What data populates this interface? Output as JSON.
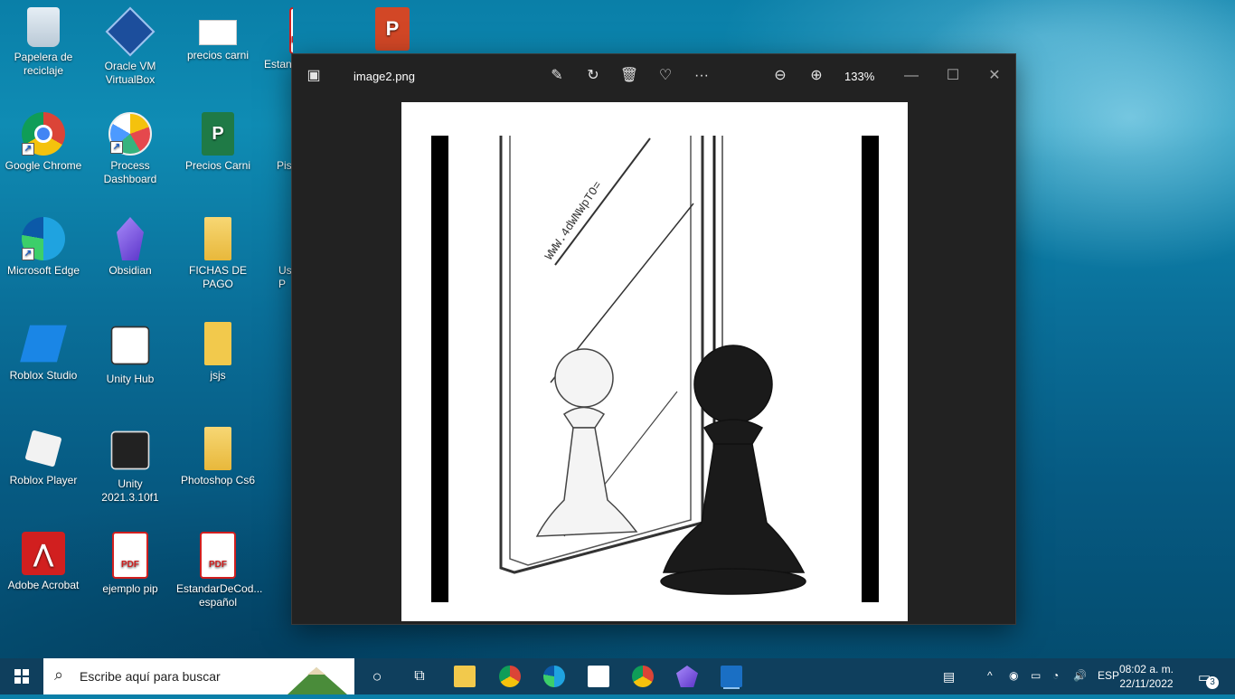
{
  "desktop": {
    "icons": [
      {
        "label": "Papelera de reciclaje",
        "icon": "recycle-bin-icon"
      },
      {
        "label": "Oracle VM VirtualBox",
        "icon": "virtualbox-icon"
      },
      {
        "label": "precios carni",
        "icon": "document-icon"
      },
      {
        "label": "Estan",
        "icon": "pdf-icon"
      },
      {
        "label": "",
        "icon": "powerpoint-icon"
      },
      {
        "label": "Google Chrome",
        "icon": "chrome-icon"
      },
      {
        "label": "Process Dashboard",
        "icon": "dashboard-icon"
      },
      {
        "label": "Precios Carni",
        "icon": "project-icon"
      },
      {
        "label": "Pish",
        "icon": "file-icon"
      },
      {
        "label": "Microsoft Edge",
        "icon": "edge-icon"
      },
      {
        "label": "Obsidian",
        "icon": "obsidian-icon"
      },
      {
        "label": "FICHAS DE PAGO",
        "icon": "folder-icon"
      },
      {
        "label": "Us P",
        "icon": "file-icon"
      },
      {
        "label": "Roblox Studio",
        "icon": "roblox-studio-icon"
      },
      {
        "label": "Unity Hub",
        "icon": "unity-hub-icon"
      },
      {
        "label": "jsjs",
        "icon": "folder-icon"
      },
      {
        "label": "Roblox Player",
        "icon": "roblox-icon"
      },
      {
        "label": "Unity 2021.3.10f1",
        "icon": "unity-icon"
      },
      {
        "label": "Photoshop Cs6",
        "icon": "folder-icon"
      },
      {
        "label": "Adobe Acrobat",
        "icon": "acrobat-icon"
      },
      {
        "label": "ejemplo pip",
        "icon": "pdf-icon"
      },
      {
        "label": "EstandarDeCod... español",
        "icon": "pdf-icon"
      }
    ],
    "pdf_badge": "PDF"
  },
  "viewer": {
    "filename": "image2.png",
    "zoom": "133%",
    "image_text": "WWW.4dWNWpTO="
  },
  "taskbar": {
    "search_placeholder": "Escribe aquí para buscar",
    "lang": "ESP",
    "time": "08:02 a. m.",
    "date": "22/11/2022",
    "notif_count": "3"
  }
}
